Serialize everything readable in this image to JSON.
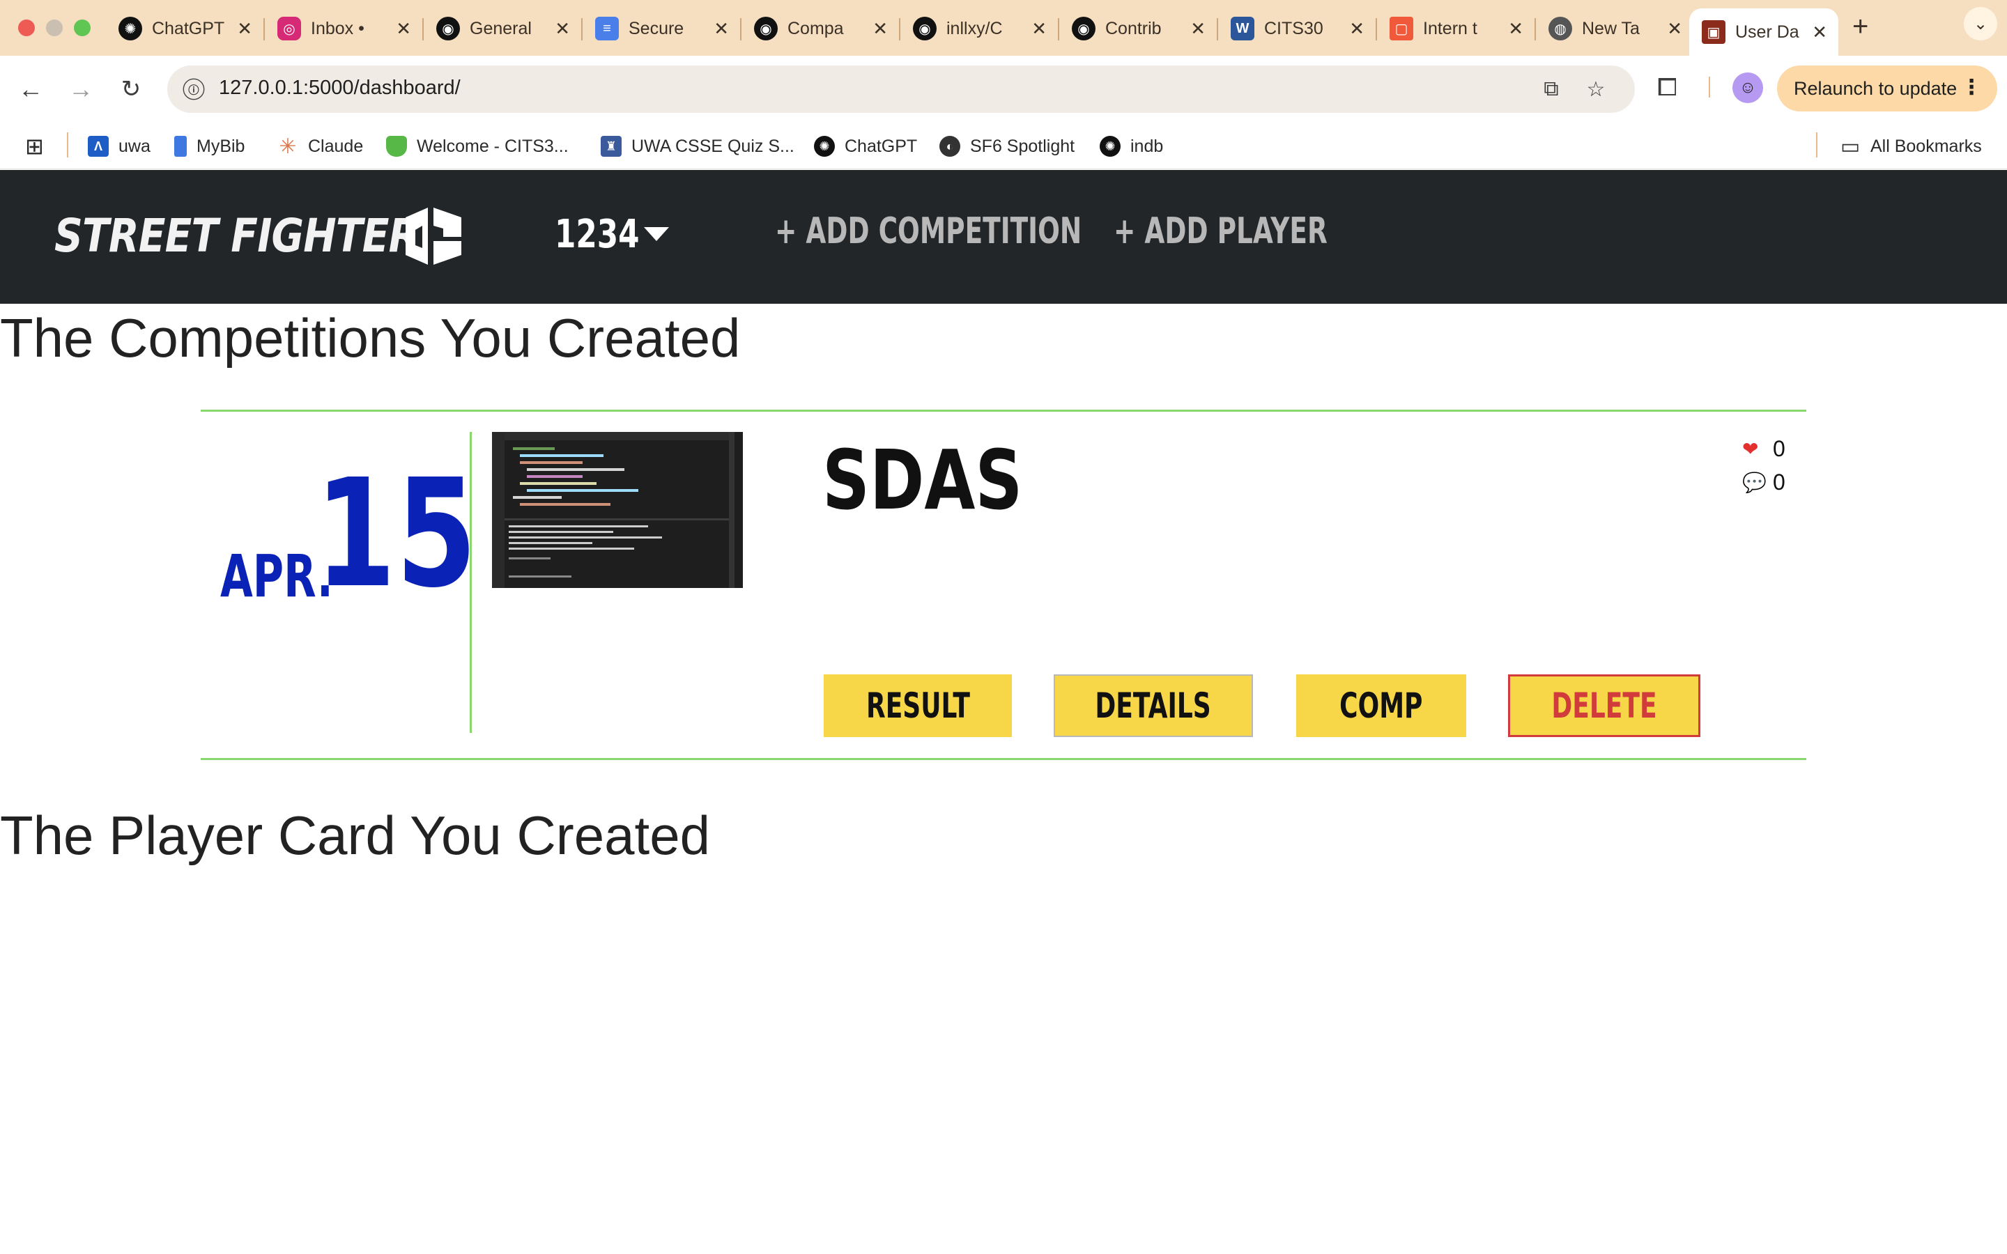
{
  "browser": {
    "tabs": [
      {
        "label": "ChatGPT",
        "icon": "chatgpt-icon",
        "color": "#111111"
      },
      {
        "label": "Inbox •",
        "icon": "instagram-icon",
        "color": "#d62976"
      },
      {
        "label": "General",
        "icon": "github-icon",
        "color": "#111111"
      },
      {
        "label": "Secure",
        "icon": "docs-icon",
        "color": "#4a7ee8"
      },
      {
        "label": "Compa",
        "icon": "github-icon",
        "color": "#111111"
      },
      {
        "label": "inllxy/C",
        "icon": "github-icon",
        "color": "#111111"
      },
      {
        "label": "Contrib",
        "icon": "github-icon",
        "color": "#111111"
      },
      {
        "label": "CITS30",
        "icon": "word-icon",
        "color": "#2b579a"
      },
      {
        "label": "Intern t",
        "icon": "intern-icon",
        "color": "#f05a3a"
      },
      {
        "label": "New Ta",
        "icon": "chrome-icon",
        "color": "#555555"
      },
      {
        "label": "User Da",
        "icon": "site-icon",
        "color": "#8a2b1c",
        "active": true
      }
    ],
    "new_tab_symbol": "+",
    "url": "127.0.0.1:5000/dashboard/",
    "relaunch_label": "Relaunch to update",
    "bookmarks": [
      {
        "label": "uwa",
        "icon": "uwa-icon",
        "color": "#1f5dc6"
      },
      {
        "label": "MyBib",
        "icon": "bookmark-icon",
        "color": "#3f78e0"
      },
      {
        "label": "Claude",
        "icon": "claude-icon",
        "color": "#d9774a"
      },
      {
        "label": "Welcome - CITS3...",
        "icon": "shield-icon",
        "color": "#58b847"
      },
      {
        "label": "UWA CSSE Quiz S...",
        "icon": "crest-icon",
        "color": "#3a5a9c"
      },
      {
        "label": "ChatGPT",
        "icon": "chatgpt-icon",
        "color": "#111111"
      },
      {
        "label": "SF6 Spotlight",
        "icon": "globe-icon",
        "color": "#333333"
      },
      {
        "label": "indb",
        "icon": "chatgpt-icon",
        "color": "#111111"
      }
    ],
    "all_bookmarks_label": "All Bookmarks"
  },
  "site": {
    "logo_text": "STREET FIGHTER",
    "username": "1234",
    "add_competition": "+ ADD COMPETITION",
    "add_player": "+ ADD PLAYER",
    "nav_bg": "#222629"
  },
  "competitions": {
    "heading": "The Competitions You Created",
    "items": [
      {
        "month": "APR.",
        "day": "15",
        "title": "SDAS",
        "likes": "0",
        "comments": "0",
        "buttons": {
          "result": "RESULT",
          "details": "DETAILS",
          "comp": "COMP",
          "delete": "DELETE"
        }
      }
    ]
  },
  "players": {
    "heading": "The Player Card You Created"
  },
  "colors": {
    "accent_green": "#8ad66f",
    "date_blue": "#0a23b6",
    "button_yellow": "#f7d748",
    "delete_red": "#d23b3b"
  }
}
